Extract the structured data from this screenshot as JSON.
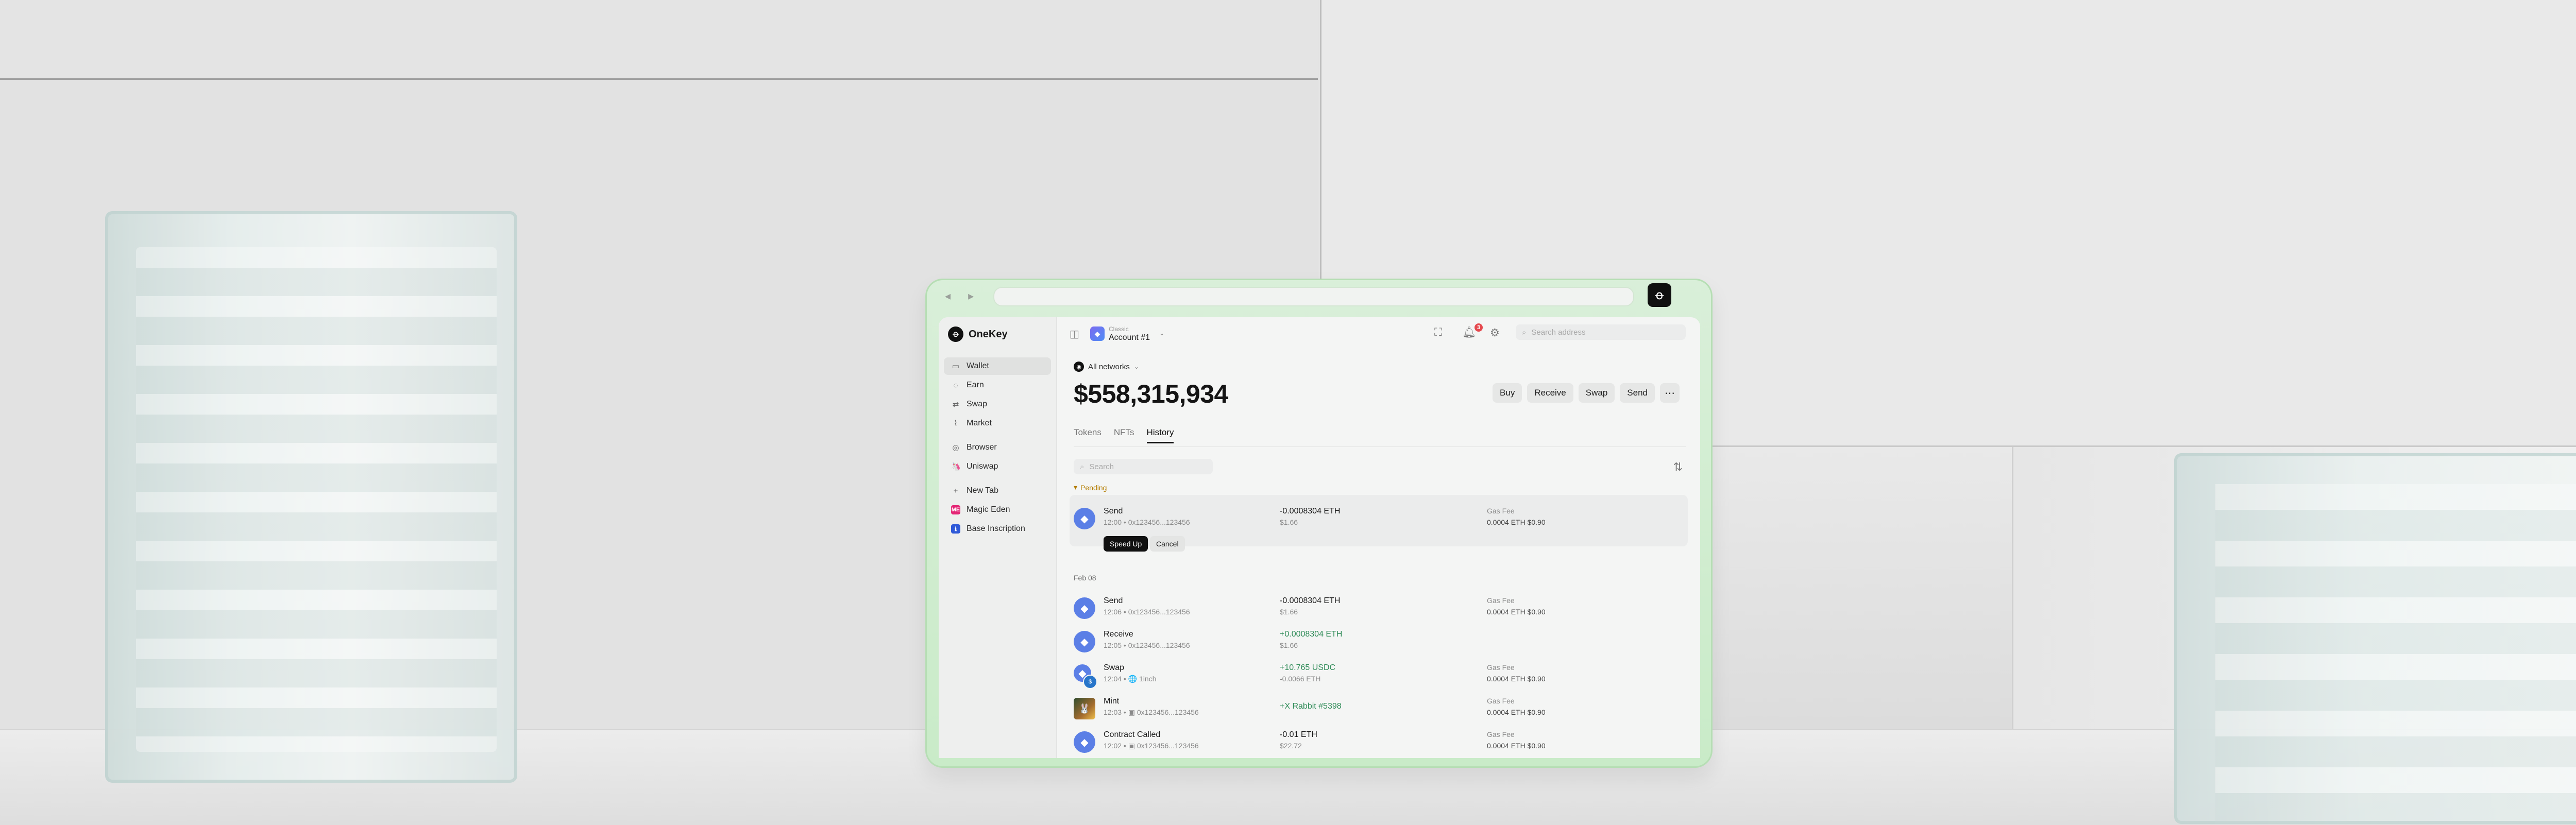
{
  "browser": {
    "nav_glyphs": "◂ ▸",
    "extension_glyph": "ꝋ"
  },
  "sidebar": {
    "brand": "OneKey",
    "brand_glyph": "ꝋ",
    "items": [
      {
        "label": "Wallet",
        "icon": "wallet-icon",
        "glyph": "▭",
        "active": true
      },
      {
        "label": "Earn",
        "icon": "earn-icon",
        "glyph": "◌"
      },
      {
        "label": "Swap",
        "icon": "swap-icon",
        "glyph": "⇄"
      },
      {
        "label": "Market",
        "icon": "market-icon",
        "glyph": "⌇"
      },
      {
        "label": "Browser",
        "icon": "browser-icon",
        "glyph": "◎"
      },
      {
        "label": "Uniswap",
        "icon": "uniswap-icon",
        "glyph": "🦄"
      },
      {
        "label": "New Tab",
        "icon": "plus-icon",
        "glyph": "+"
      },
      {
        "label": "Magic Eden",
        "icon": "magic-eden-icon",
        "glyph": "ME",
        "color": "#e42575"
      },
      {
        "label": "Base Inscription",
        "icon": "base-inscription-icon",
        "glyph": "ℹ",
        "color": "#2f5ad8"
      }
    ]
  },
  "header": {
    "panel_glyph": "◫",
    "account_type": "Classic",
    "account_name": "Account #1",
    "account_glyph": "◆",
    "chevron": "⌄",
    "expand_glyph": "⛶",
    "bell_glyph": "🔔︎",
    "settings_glyph": "⚙",
    "notification_count": "3",
    "search_glyph": "⌕",
    "search_placeholder": "Search address"
  },
  "wallet": {
    "network_label": "All networks",
    "network_chevron": "⌄",
    "network_glyph": "◉",
    "balance": "$558,315,934",
    "actions": [
      "Buy",
      "Receive",
      "Swap",
      "Send"
    ],
    "more_glyph": "⋯",
    "tabs": [
      {
        "label": "Tokens",
        "active": false
      },
      {
        "label": "NFTs",
        "active": false
      },
      {
        "label": "History",
        "active": true
      }
    ],
    "history_search_placeholder": "Search",
    "search_glyph": "⌕",
    "sort_glyph": "⇅"
  },
  "history": {
    "pending_label": "Pending",
    "pending_glyph": "▾",
    "date_label": "Feb 08",
    "gas_label": "Gas Fee",
    "speed_up": "Speed Up",
    "cancel": "Cancel",
    "pending": {
      "title": "Send",
      "meta": "12:00 • 0x123456...123456",
      "amount": "-0.0008304 ETH",
      "fiat": "$1.66",
      "gas": "0.0004 ETH $0.90"
    },
    "rows": [
      {
        "title": "Send",
        "meta": "12:06 • 0x123456...123456",
        "amount": "-0.0008304 ETH",
        "fiat": "$1.66",
        "gas": "0.0004 ETH $0.90",
        "positive": false
      },
      {
        "title": "Receive",
        "meta": "12:05 • 0x123456...123456",
        "amount": "+0.0008304 ETH",
        "fiat": "$1.66",
        "gas": "",
        "positive": true
      },
      {
        "title": "Swap",
        "meta": "12:04 • 🌐 1inch",
        "amount": "+10.765 USDC",
        "fiat": "-0.0066 ETH",
        "gas": "0.0004 ETH $0.90",
        "positive": true
      },
      {
        "title": "Mint",
        "meta": "12:03 • ▣ 0x123456...123456",
        "amount": "+X Rabbit #5398",
        "fiat": "",
        "gas": "0.0004 ETH $0.90",
        "positive": true
      },
      {
        "title": "Contract Called",
        "meta": "12:02 • ▣ 0x123456...123456",
        "amount": "-0.01 ETH",
        "fiat": "$22.72",
        "gas": "0.0004 ETH $0.90",
        "positive": false
      }
    ],
    "eth_glyph": "◆",
    "usdc_glyph": "$",
    "nft_glyph": "🐰"
  },
  "colors": {
    "accent": "#111111",
    "positive": "#2e8b57",
    "pending": "#b47d00",
    "frame": "#c9ebc8",
    "badge": "#e5484d"
  }
}
